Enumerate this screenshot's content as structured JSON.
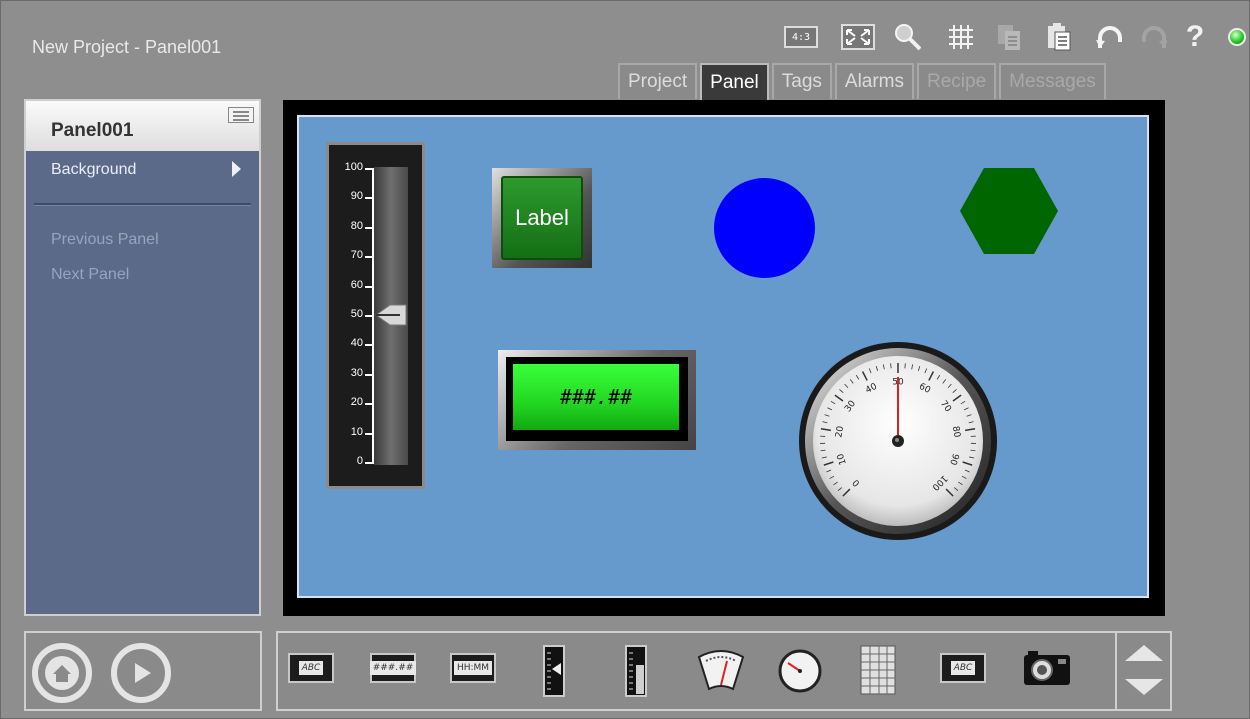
{
  "window": {
    "title": "New Project - Panel001"
  },
  "toolbar": {
    "aspect_label": "4:3",
    "icons": [
      "aspect-ratio-icon",
      "fullscreen-icon",
      "zoom-icon",
      "grid-icon",
      "copy-icon",
      "paste-icon",
      "undo-icon",
      "redo-icon",
      "help-icon",
      "status-led-icon"
    ],
    "help_label": "?"
  },
  "tabs": [
    {
      "label": "Project",
      "state": "normal"
    },
    {
      "label": "Panel",
      "state": "active"
    },
    {
      "label": "Tags",
      "state": "normal"
    },
    {
      "label": "Alarms",
      "state": "normal"
    },
    {
      "label": "Recipe",
      "state": "disabled"
    },
    {
      "label": "Messages",
      "state": "disabled"
    }
  ],
  "sidebar": {
    "panel_name": "Panel001",
    "items": [
      {
        "label": "Background"
      },
      {
        "label": "Previous Panel"
      },
      {
        "label": "Next Panel"
      }
    ]
  },
  "canvas": {
    "background_color": "#6699cc",
    "slider": {
      "ticks": [
        "100",
        "90",
        "80",
        "70",
        "60",
        "50",
        "40",
        "30",
        "20",
        "10",
        "0"
      ],
      "value": 50
    },
    "label_button": {
      "text": "Label",
      "color": "#1f8a1f"
    },
    "circle_color": "#0000ff",
    "hexagon_color": "#006600",
    "numeric_display": {
      "text": "###.##",
      "color": "#33ff33"
    },
    "gauge": {
      "ticks": [
        "0",
        "10",
        "20",
        "30",
        "40",
        "50",
        "60",
        "70",
        "80",
        "90",
        "100"
      ],
      "value": 50
    }
  },
  "bottom_controls": {
    "buttons": [
      "home-button",
      "play-button"
    ]
  },
  "palette": {
    "items": [
      {
        "name": "text-label-widget",
        "text": "ABC"
      },
      {
        "name": "numeric-widget",
        "text": "###.##"
      },
      {
        "name": "time-widget",
        "text": "HH:MM"
      },
      {
        "name": "vertical-slider-widget",
        "text": ""
      },
      {
        "name": "vertical-bar-widget",
        "text": ""
      },
      {
        "name": "arc-meter-widget",
        "text": ""
      },
      {
        "name": "round-gauge-widget",
        "text": ""
      },
      {
        "name": "table-widget",
        "text": ""
      },
      {
        "name": "text-box-widget",
        "text": "ABC"
      },
      {
        "name": "camera-widget",
        "text": ""
      }
    ]
  }
}
